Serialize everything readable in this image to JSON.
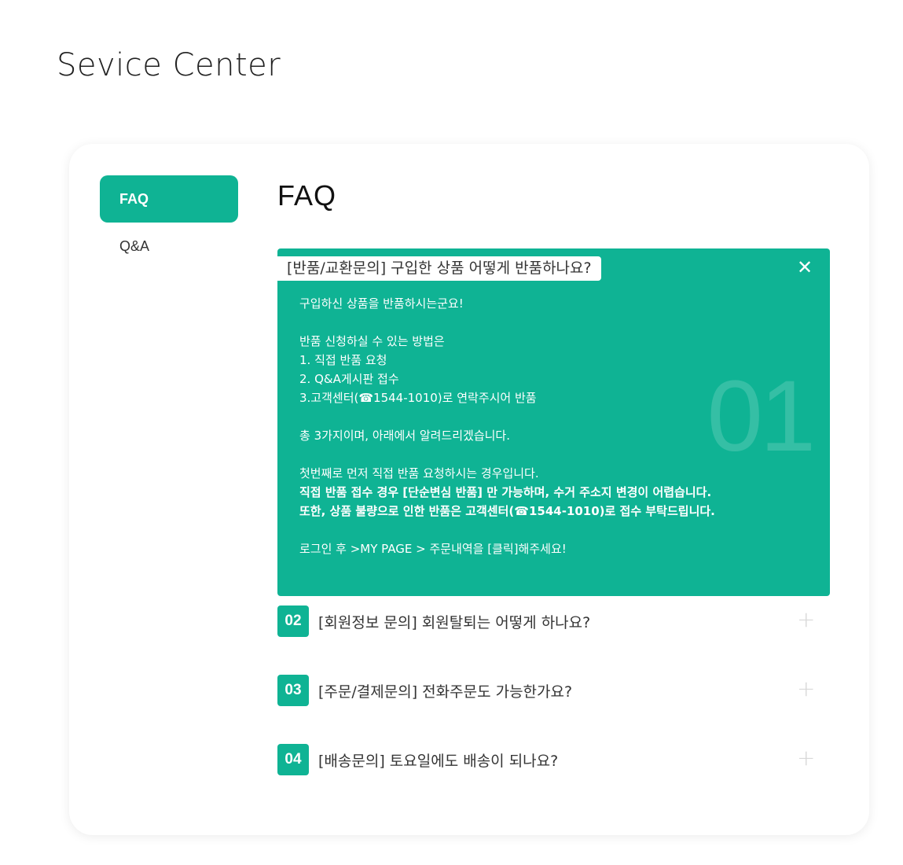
{
  "page": {
    "title": "Sevice Center"
  },
  "sidebar": {
    "items": [
      {
        "label": "FAQ",
        "active": true
      },
      {
        "label": "Q&A",
        "active": false
      }
    ]
  },
  "main": {
    "title": "FAQ",
    "open_faq": {
      "number": "01",
      "question": "[반품/교환문의] 구입한 상품 어떻게 반품하나요?",
      "answer_lines": [
        {
          "text": "구입하신 상품을 반품하시는군요!",
          "bold": false
        },
        {
          "text": "",
          "bold": false
        },
        {
          "text": "반품 신청하실 수 있는 방법은",
          "bold": false
        },
        {
          "text": "1. 직접 반품 요청",
          "bold": false
        },
        {
          "text": "2. Q&A게시판 접수",
          "bold": false
        },
        {
          "text": "3.고객센터(☎1544-1010)로 연락주시어 반품",
          "bold": false
        },
        {
          "text": "",
          "bold": false
        },
        {
          "text": "총 3가지이며, 아래에서 알려드리겠습니다.",
          "bold": false
        },
        {
          "text": "",
          "bold": false
        },
        {
          "text": "첫번째로 먼저 직접 반품 요청하시는 경우입니다.",
          "bold": false
        },
        {
          "text": "직접 반품 접수 경우 [단순변심 반품] 만 가능하며, 수거 주소지 변경이 어렵습니다.",
          "bold": true
        },
        {
          "text": "또한, 상품 불량으로 인한 반품은 고객센터(☎1544-1010)로 접수 부탁드립니다.",
          "bold": true
        },
        {
          "text": "",
          "bold": false
        },
        {
          "text": "로그인 후 >MY PAGE > 주문내역을 [클릭]해주세요!",
          "bold": false
        }
      ]
    },
    "faqs": [
      {
        "number": "02",
        "question": "[회원정보 문의] 회원탈퇴는 어떻게 하나요?"
      },
      {
        "number": "03",
        "question": "[주문/결제문의] 전화주문도 가능한가요?"
      },
      {
        "number": "04",
        "question": "[배송문의] 토요일에도 배송이 되나요?"
      }
    ]
  },
  "icons": {
    "close": "close-icon",
    "expand": "plus-icon"
  },
  "colors": {
    "accent": "#0fb394",
    "text": "#333333"
  }
}
